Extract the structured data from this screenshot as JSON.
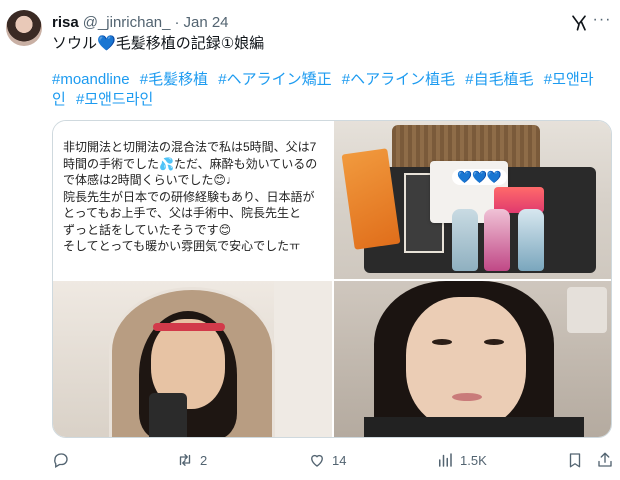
{
  "author": {
    "name": "risa",
    "handle": "@_jinrichan_",
    "separator": "·",
    "date": "Jan 24"
  },
  "tweet": {
    "text_before": "ソウル",
    "text_after": "毛髪移植の記録①娘編"
  },
  "hashtags": [
    "#moandline",
    "#毛髪移植",
    "#ヘアライン矯正",
    "#ヘアライン植毛",
    "#自毛植毛",
    "#모앤라인",
    "#모앤드라인"
  ],
  "media": {
    "text_image_lines": [
      "非切開法と切開法の混合法で私は5時間、父は7",
      "時間の手術でした💦ただ、麻酔も効いているの",
      "で体感は2時間くらいでした😊♩",
      "院長先生が日本での研修経験もあり、日本語が",
      "とってもお上手で、父は手術中、院長先生と",
      "ずっと話をしていたそうです😊",
      "そしてとっても暖かい雰囲気で安心でしたㅠ"
    ],
    "overlay_hearts": "💙💙💙"
  },
  "actions": {
    "reply_count": "",
    "retweet_count": "2",
    "like_count": "14",
    "views_count": "1.5K"
  },
  "colors": {
    "link": "#1d9bf0",
    "muted": "#536471",
    "text": "#0f1419"
  }
}
